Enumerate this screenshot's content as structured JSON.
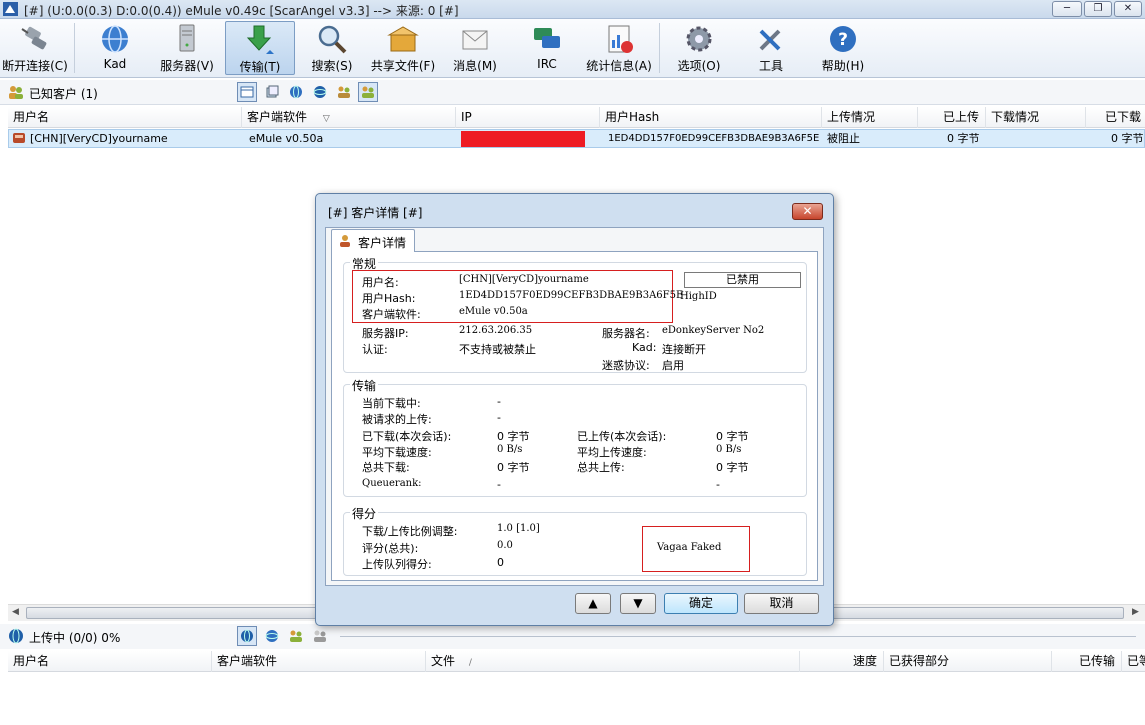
{
  "window": {
    "title": "[#] (U:0.0(0.3) D:0.0(0.4)) eMule v0.49c [ScarAngel v3.3] --> 来源: 0 [#]",
    "controls": [
      "─",
      "❐",
      "✕"
    ]
  },
  "toolbar": {
    "buttons": [
      {
        "label": "断开连接(C)"
      },
      {
        "label": "Kad"
      },
      {
        "label": "服务器(V)"
      },
      {
        "label": "传输(T)"
      },
      {
        "label": "搜索(S)"
      },
      {
        "label": "共享文件(F)"
      },
      {
        "label": "消息(M)"
      },
      {
        "label": "IRC"
      },
      {
        "label": "统计信息(A)"
      },
      {
        "label": "选项(O)"
      },
      {
        "label": "工具"
      },
      {
        "label": "帮助(H)"
      }
    ]
  },
  "known_clients": {
    "header_label": "已知客户 (1)",
    "columns": [
      "用户名",
      "客户端软件",
      "IP",
      "用户Hash",
      "上传情况",
      "已上传",
      "下载情况",
      "已下载"
    ],
    "sort_indicator": "▽",
    "rows": [
      {
        "username": "[CHN][VeryCD]yourname",
        "client": "eMule v0.50a",
        "hash": "1ED4DD157F0ED99CEFB3DBAE9B3A6F5E",
        "upload_status": "被阻止",
        "uploaded": "0 字节",
        "downloaded": "0 字节"
      }
    ]
  },
  "uploads": {
    "header_label": "上传中 (0/0) 0%",
    "columns": [
      "用户名",
      "客户端软件",
      "文件",
      "速度",
      "已获得部分",
      "已传输",
      "已等"
    ],
    "sort_indicator": "/"
  },
  "dialog": {
    "title": "[#] 客户详情 [#]",
    "close": "✕",
    "tab_label": "客户详情",
    "general": {
      "title": "常规",
      "username_label": "用户名:",
      "username_value": "[CHN][VeryCD]yourname",
      "hash_label": "用户Hash:",
      "hash_value": "1ED4DD157F0ED99CEFB3DBAE9B3A6F5E",
      "client_label": "客户端软件:",
      "client_value": "eMule v0.50a",
      "disabled_label": "已禁用",
      "highid": "HighID",
      "server_ip_label": "服务器IP:",
      "server_ip_value": "212.63.206.35",
      "server_name_label": "服务器名:",
      "server_name_value": "eDonkeyServer No2",
      "auth_label": "认证:",
      "auth_value": "不支持或被禁止",
      "kad_label": "Kad:",
      "kad_value": "连接断开",
      "obfuscation_label": "迷惑协议:",
      "obfuscation_value": "启用"
    },
    "transfer": {
      "title": "传输",
      "cur_download_label": "当前下载中:",
      "cur_download_value": "-",
      "requested_upload_label": "被请求的上传:",
      "requested_upload_value": "-",
      "dl_session_label": "已下载(本次会话):",
      "dl_session_value": "0 字节",
      "ul_session_label": "已上传(本次会话):",
      "ul_session_value": "0 字节",
      "avg_dl_label": "平均下载速度:",
      "avg_dl_value": "0 B/s",
      "avg_ul_label": "平均上传速度:",
      "avg_ul_value": "0 B/s",
      "total_dl_label": "总共下载:",
      "total_dl_value": "0 字节",
      "total_ul_label": "总共上传:",
      "total_ul_value": "0 字节",
      "queuerank_label": "Queuerank:",
      "queuerank_value": "-",
      "queuerank_right": "-"
    },
    "score": {
      "title": "得分",
      "ratio_label": "下载/上传比例调整:",
      "ratio_value": "1.0 [1.0]",
      "rating_label": "评分(总共):",
      "rating_value": "0.0",
      "queue_score_label": "上传队列得分:",
      "queue_score_value": "0",
      "faked_note": "Vagaa Faked"
    },
    "buttons": {
      "up": "▲",
      "down": "▼",
      "ok": "确定",
      "cancel": "取消"
    }
  },
  "colors": {
    "redaction": "#ee1c24",
    "highlight_box": "#d61f1f",
    "selected_row": "#d9ecfb"
  }
}
